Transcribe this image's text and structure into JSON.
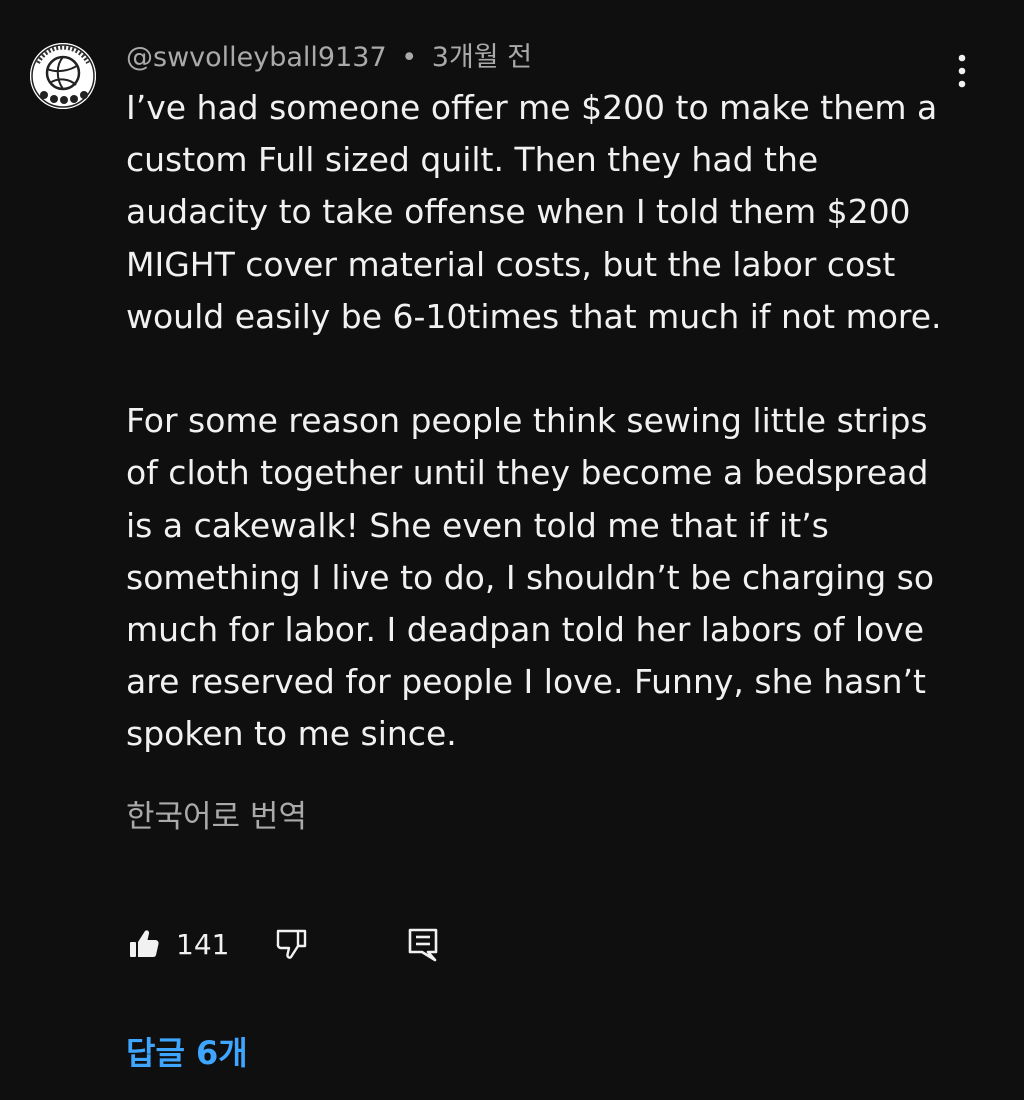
{
  "comment": {
    "author": "@swvolleyball9137",
    "separator": "•",
    "time": "3개월 전",
    "avatar_icon": "volleyball-avatar",
    "body_lines_p1": [
      "I’ve had someone offer me $200 to make them a",
      "custom Full sized quilt. Then they had the",
      "audacity to take offense when I told them $200",
      "MIGHT cover material costs, but the labor cost",
      "would easily be 6-10times that much if not more."
    ],
    "body_lines_p2": [
      "For some reason people think sewing little strips",
      "of cloth together until they become a bedspread",
      "is a cakewalk! She even told me that if it’s",
      "something I live to do, I shouldn’t be charging so",
      "much for labor. I deadpan told her labors of love",
      "are reserved for people I love. Funny, she hasn’t",
      "spoken to me since."
    ],
    "translate_label": "한국어로 번역"
  },
  "actions": {
    "like_count": "141",
    "like_icon": "thumbs-up-icon",
    "dislike_icon": "thumbs-down-icon",
    "reply_icon": "reply-icon",
    "menu_icon": "more-vert-icon"
  },
  "replies": {
    "label": "답글 6개"
  },
  "colors": {
    "background": "#0f0f0f",
    "text": "#f1f1f1",
    "secondary": "#aaaaaa",
    "link": "#3ea6ff"
  }
}
